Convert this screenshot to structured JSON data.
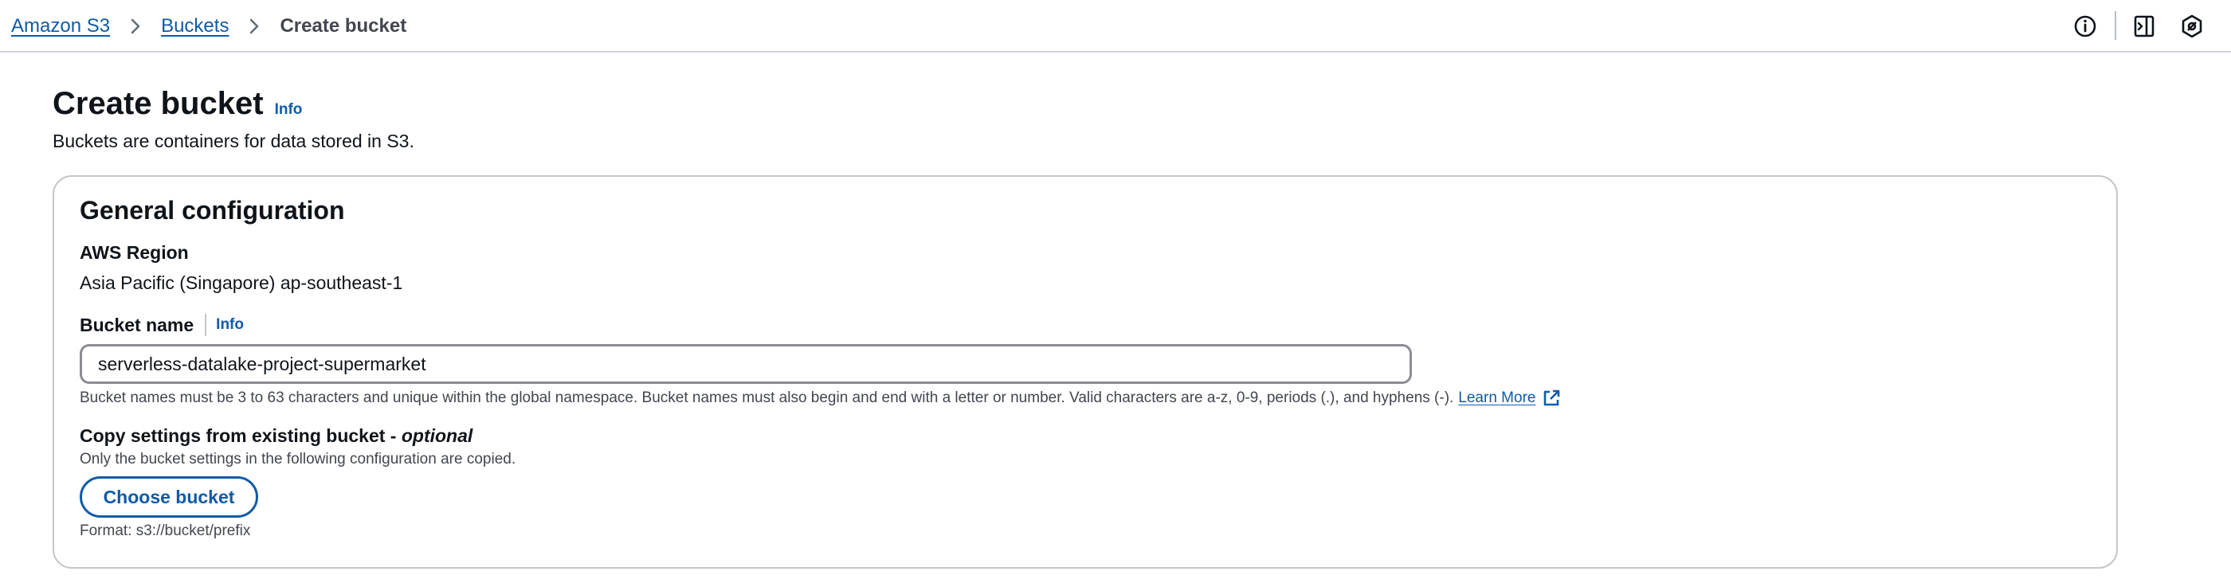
{
  "breadcrumb": {
    "items": [
      "Amazon S3",
      "Buckets"
    ],
    "current": "Create bucket"
  },
  "top_icons": [
    "info-circle-icon",
    "side-panel-icon",
    "settings-hex-icon"
  ],
  "header": {
    "title": "Create bucket",
    "info_label": "Info",
    "description": "Buckets are containers for data stored in S3."
  },
  "general_config": {
    "title": "General configuration",
    "region_label": "AWS Region",
    "region_value": "Asia Pacific (Singapore) ap-southeast-1",
    "bucket_name_label": "Bucket name",
    "bucket_name_info": "Info",
    "bucket_name_value": "serverless-datalake-project-supermarket",
    "bucket_name_hint": "Bucket names must be 3 to 63 characters and unique within the global namespace. Bucket names must also begin and end with a letter or number. Valid characters are a-z, 0-9, periods (.), and hyphens (-).",
    "learn_more": "Learn More",
    "copy_label": "Copy settings from existing bucket - ",
    "copy_label_optional": "optional",
    "copy_desc": "Only the bucket settings in the following configuration are copied.",
    "choose_button": "Choose bucket",
    "format_hint": "Format: s3://bucket/prefix"
  },
  "colors": {
    "link": "#0f5ba7",
    "text": "#0f141a",
    "muted": "#424650",
    "border": "#c6c6cd"
  }
}
